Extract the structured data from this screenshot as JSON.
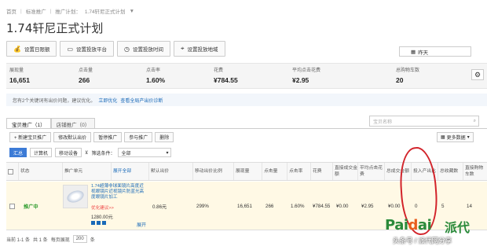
{
  "breadcrumb": {
    "home": "首页",
    "level1": "标准推广",
    "level2_label": "推广计划：",
    "current": "1.74轩尼正式计划",
    "caret": "▼"
  },
  "page_title": "1.74轩尼正式计划",
  "toolbar": {
    "buttons": [
      {
        "label": "设置日限额",
        "icon": "money-bag-icon"
      },
      {
        "label": "设置投放平台",
        "icon": "monitor-icon"
      },
      {
        "label": "设置投放时间",
        "icon": "clock-icon"
      },
      {
        "label": "设置投放地域",
        "icon": "map-pin-icon"
      }
    ],
    "date_select": "昨天"
  },
  "stats": [
    {
      "label": "展现量",
      "value": "16,651"
    },
    {
      "label": "点击量",
      "value": "266"
    },
    {
      "label": "点击率",
      "value": "1.60%"
    },
    {
      "label": "花费",
      "value": "¥784.55"
    },
    {
      "label": "平均点击花费",
      "value": "¥2.95"
    },
    {
      "label": "总购物车数",
      "value": "20"
    }
  ],
  "notice": {
    "text": "您有2个关键词有出价问题，建议优化。",
    "link1": "立即优化",
    "link2": "查看全局产出价诊断"
  },
  "tabs": [
    {
      "label": "宝贝推广（1）",
      "active": true
    },
    {
      "label": "店铺推广（0）",
      "active": false
    }
  ],
  "search_placeholder": "宝贝名称",
  "actions": [
    "+ 新建宝贝推广",
    "修改默认出价",
    "暂停推广",
    "参与推广",
    "删除"
  ],
  "more_data": "更多数据",
  "filter": {
    "summary": "汇总",
    "computer": "计算机",
    "mobile": "移动设备",
    "cond_label": "筛选条件：",
    "cond_value": "全部"
  },
  "table": {
    "headers": [
      "状态",
      "推广单元",
      "展开全部",
      "默认出价",
      "移动出价比例",
      "展现量",
      "点击量",
      "点击率",
      "花费",
      "直接成交金额",
      "平均点击花费",
      "总成交金额",
      "投入产出比",
      "总收藏数",
      "直接购物车数"
    ],
    "row": {
      "status": "推广中",
      "product_title": "1.74超薄非球面镜片高度近视眼镜片近视镜片防蓝光高度眼镜片加工",
      "promo": "优化建议>>",
      "price": "1280.00元",
      "expand": "展开",
      "default_bid": "0.86元",
      "mobile_ratio": "299%",
      "impressions": "16,651",
      "clicks": "266",
      "ctr": "1.60%",
      "cost": "¥784.55",
      "direct_deal": "¥0.00",
      "avg_cpc": "¥2.95",
      "total_deal": "¥0.00",
      "roi": "0",
      "favorites": "5",
      "direct_cart": "14"
    }
  },
  "footer": {
    "range": "当前 1-1 条",
    "total": "共 1 条",
    "per_page_label": "每页展现",
    "per_page": "200",
    "unit": "条"
  },
  "watermark": {
    "pai": "Pai",
    "d": "d",
    "ai": "ai",
    "cn": "派代",
    "bottom": "头条号 / 派代网分享"
  },
  "colors": {
    "accent": "#3c7bd6",
    "link": "#1a6ab8",
    "status_green": "#2a9a2a",
    "highlight_row": "#fff9e5",
    "annotation_red": "#d2232a"
  }
}
